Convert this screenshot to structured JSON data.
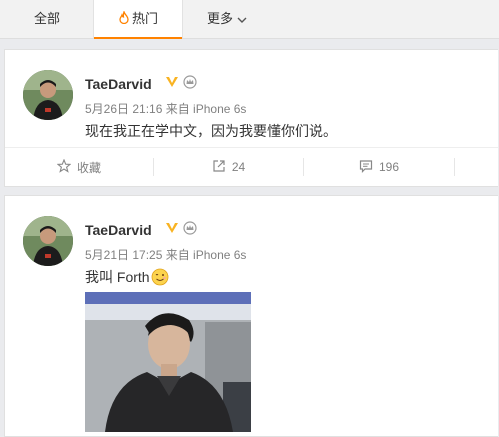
{
  "tabs": {
    "all": "全部",
    "hot": "热门",
    "more": "更多"
  },
  "posts": [
    {
      "username": "TaeDarvid",
      "meta": "5月26日 21:16 来自 iPhone 6s",
      "text": "现在我正在学中文，因为我要懂你们说。",
      "actions": {
        "favorite": "收藏",
        "repost": "24",
        "comment": "196"
      }
    },
    {
      "username": "TaeDarvid",
      "meta": "5月21日 17:25 来自 iPhone 6s",
      "text": "我叫 Forth"
    }
  ],
  "colors": {
    "accent": "#ff8200",
    "verified": "#f9b322"
  }
}
